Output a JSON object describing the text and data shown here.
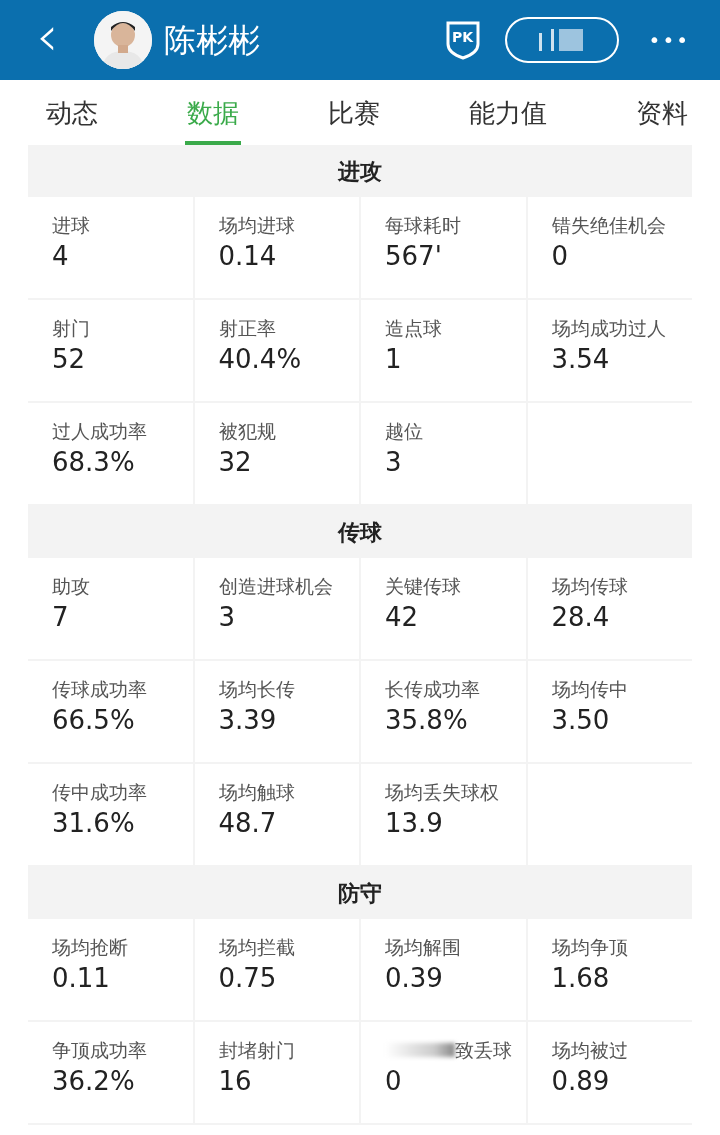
{
  "header": {
    "back": "‹",
    "name": "陈彬彬",
    "pk": "PK",
    "more": "•••"
  },
  "tabs": [
    {
      "label": "动态",
      "selected": false
    },
    {
      "label": "数据",
      "selected": true
    },
    {
      "label": "比赛",
      "selected": false
    },
    {
      "label": "能力值",
      "selected": false
    },
    {
      "label": "资料",
      "selected": false
    }
  ],
  "sections": [
    {
      "title": "进攻",
      "stats": [
        {
          "label": "进球",
          "value": "4"
        },
        {
          "label": "场均进球",
          "value": "0.14"
        },
        {
          "label": "每球耗时",
          "value": "567'"
        },
        {
          "label": "错失绝佳机会",
          "value": "0"
        },
        {
          "label": "射门",
          "value": "52"
        },
        {
          "label": "射正率",
          "value": "40.4%"
        },
        {
          "label": "造点球",
          "value": "1"
        },
        {
          "label": "场均成功过人",
          "value": "3.54"
        },
        {
          "label": "过人成功率",
          "value": "68.3%"
        },
        {
          "label": "被犯规",
          "value": "32"
        },
        {
          "label": "越位",
          "value": "3"
        }
      ]
    },
    {
      "title": "传球",
      "stats": [
        {
          "label": "助攻",
          "value": "7"
        },
        {
          "label": "创造进球机会",
          "value": "3"
        },
        {
          "label": "关键传球",
          "value": "42"
        },
        {
          "label": "场均传球",
          "value": "28.4"
        },
        {
          "label": "传球成功率",
          "value": "66.5%"
        },
        {
          "label": "场均长传",
          "value": "3.39"
        },
        {
          "label": "长传成功率",
          "value": "35.8%"
        },
        {
          "label": "场均传中",
          "value": "3.50"
        },
        {
          "label": "传中成功率",
          "value": "31.6%"
        },
        {
          "label": "场均触球",
          "value": "48.7"
        },
        {
          "label": "场均丢失球权",
          "value": "13.9"
        }
      ]
    },
    {
      "title": "防守",
      "stats": [
        {
          "label": "场均抢断",
          "value": "0.11"
        },
        {
          "label": "场均拦截",
          "value": "0.75"
        },
        {
          "label": "场均解围",
          "value": "0.39"
        },
        {
          "label": "场均争顶",
          "value": "1.68"
        },
        {
          "label": "争顶成功率",
          "value": "36.2%"
        },
        {
          "label": "封堵射门",
          "value": "16"
        },
        {
          "label": "致丢球",
          "value": "0",
          "blurred": true
        },
        {
          "label": "场均被过",
          "value": "0.89"
        }
      ]
    }
  ]
}
